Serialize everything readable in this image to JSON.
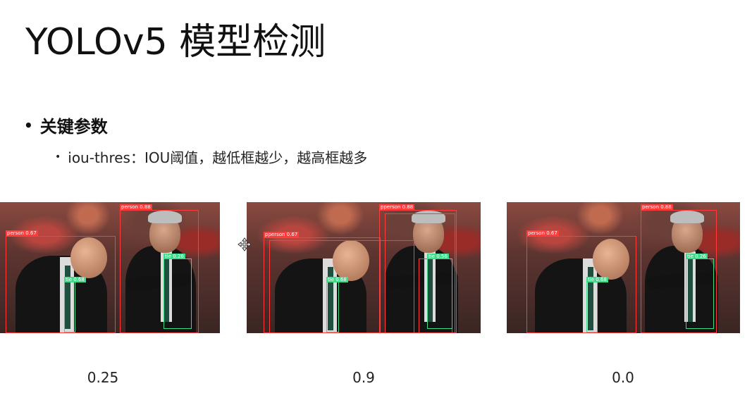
{
  "slide": {
    "title": "YOLOv5 模型检测",
    "bullet_main": "关键参数",
    "bullet_sub": "iou-thres：IOU阈值，越低框越少，越高框越多"
  },
  "panels": [
    {
      "caption": "0.25",
      "boxes": {
        "person_left": "person 0.67",
        "person_right": "person 0.88",
        "tie_left": "tie 0.68",
        "tie_right": "tie 0.26"
      }
    },
    {
      "caption": "0.9",
      "boxes": {
        "person_left": "pperson 0.67",
        "person_right": "pperson 0.88",
        "tie_left": "tie 0.68",
        "tie_right": "tie 0.56"
      }
    },
    {
      "caption": "0.0",
      "boxes": {
        "person_left": "person 0.67",
        "person_right": "person 0.88",
        "tie_left": "tie 0.68",
        "tie_right": "tie 0.26"
      }
    }
  ],
  "colors": {
    "person_box": "#ff3b3b",
    "tie_box": "#3fd98a"
  },
  "icons": {
    "cursor": "move-cursor-icon"
  }
}
